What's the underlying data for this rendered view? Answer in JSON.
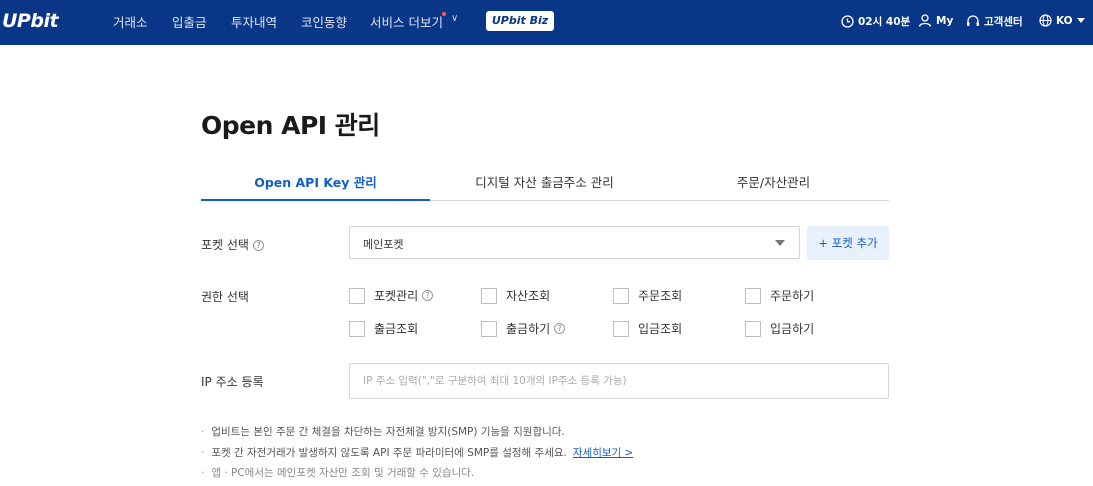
{
  "header": {
    "logo": "UPbit",
    "nav": [
      "거래소",
      "입출금",
      "투자내역",
      "코인동향",
      "서비스 더보기"
    ],
    "biz_label": "UPbit Biz",
    "time": "02시 40분",
    "my": "My",
    "support": "고객센터",
    "lang": "KO",
    "colors": {
      "bar": "#093687",
      "new_dot": "#ff5a5a"
    }
  },
  "page": {
    "title": "Open API 관리"
  },
  "tabs": [
    "Open API Key 관리",
    "디지털 자산 출금주소 관리",
    "주문/자산관리"
  ],
  "form": {
    "pocket_label": "포켓 선택",
    "pocket_value": "메인포켓",
    "add_pocket": "+ 포켓 추가",
    "perm_label": "권한 선택",
    "perms": [
      "포켓관리",
      "자산조회",
      "주문조회",
      "주문하기",
      "출금조회",
      "출금하기",
      "입금조회",
      "입금하기"
    ],
    "ip_label": "IP 주소 등록",
    "ip_placeholder": "IP 주소 입력(\",\"로 구분하여 최대 10개의 IP주소 등록 가능)"
  },
  "notes": {
    "n1": "업비트는 본인 주문 간 체결을 차단하는 자전체결 방지(SMP) 기능을 지원합니다.",
    "n2": "포켓 간 자전거래가 발생하지 않도록 API 주문 파라미터에 SMP를 설정해 주세요.",
    "n2_link": "자세히보기 >",
    "n3": "앱 · PC에서는 메인포켓 자산만 조회 및 거래할 수 있습니다."
  },
  "accent": "#115dcb"
}
